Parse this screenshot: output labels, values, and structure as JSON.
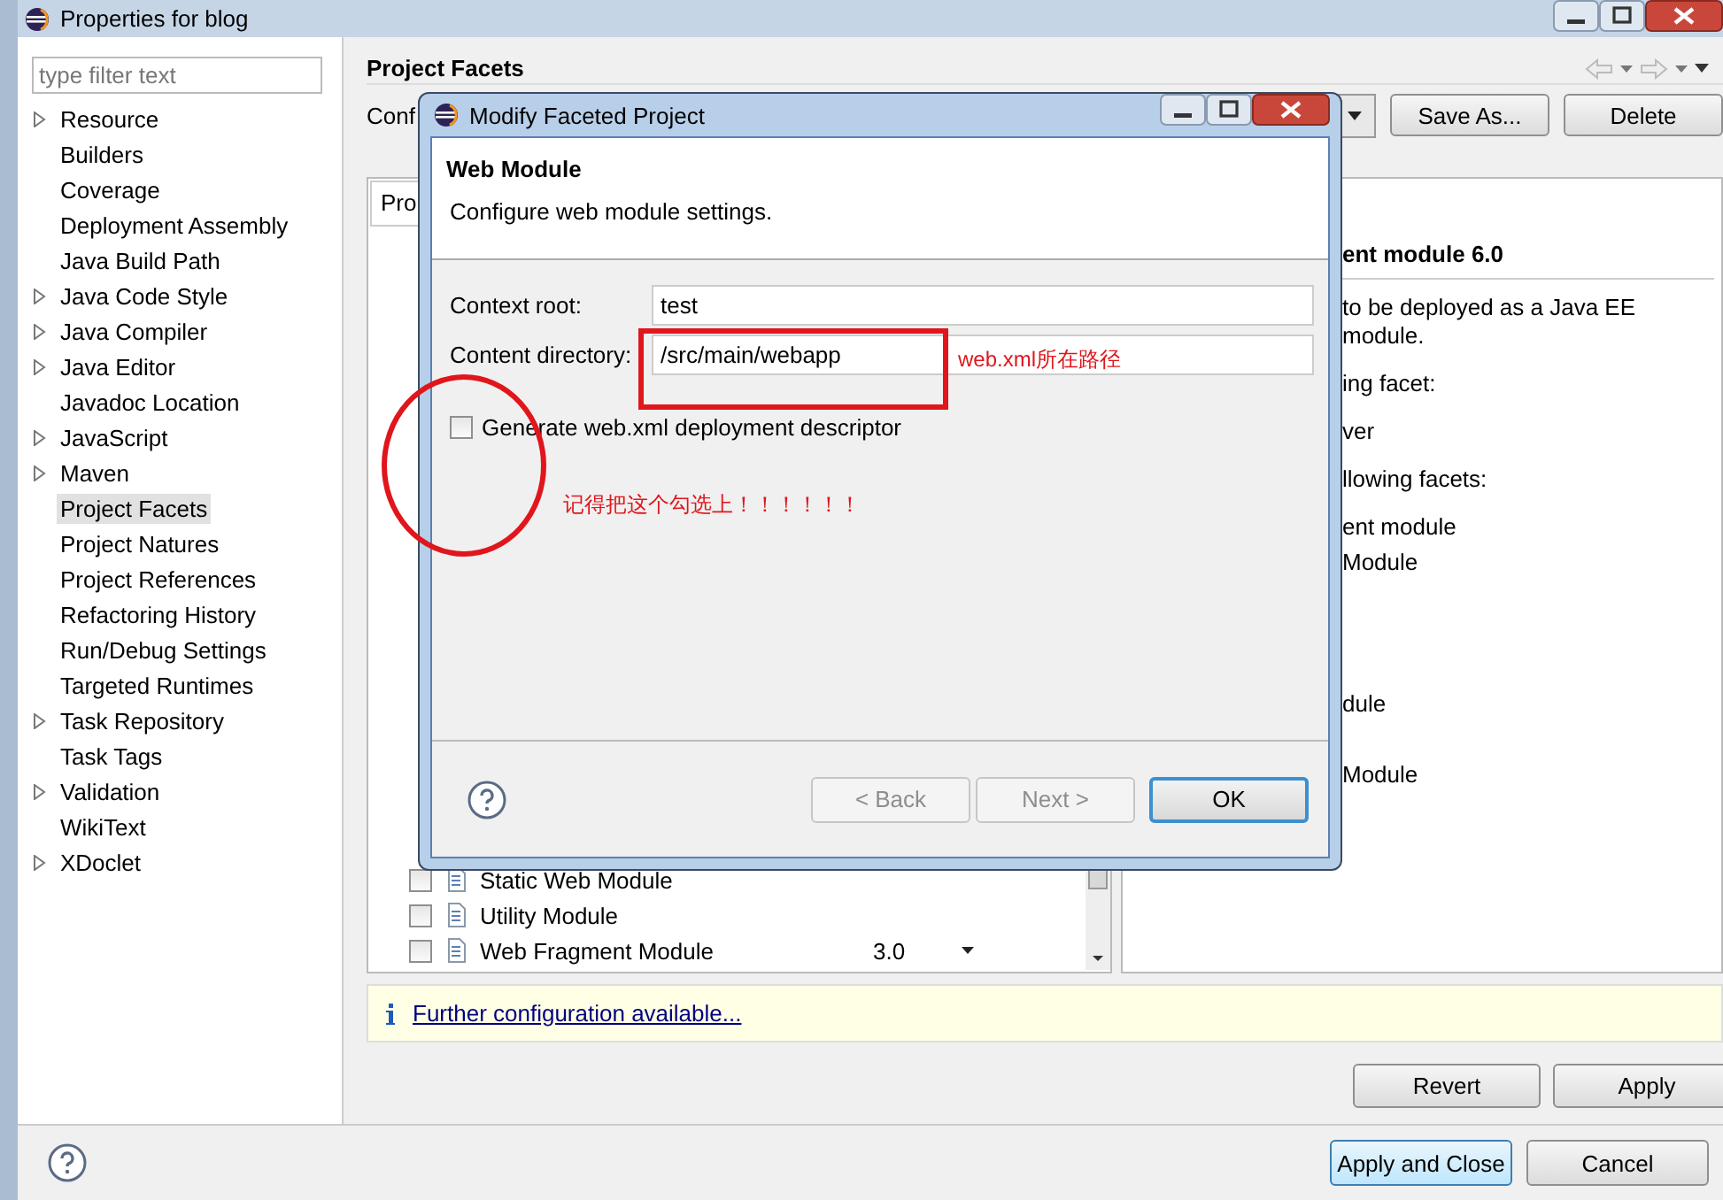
{
  "window": {
    "title": "Properties for blog"
  },
  "sidebar": {
    "filter_placeholder": "type filter text",
    "items": [
      {
        "label": "Resource",
        "expandable": true,
        "selected": false
      },
      {
        "label": "Builders",
        "expandable": false,
        "selected": false
      },
      {
        "label": "Coverage",
        "expandable": false,
        "selected": false
      },
      {
        "label": "Deployment Assembly",
        "expandable": false,
        "selected": false
      },
      {
        "label": "Java Build Path",
        "expandable": false,
        "selected": false
      },
      {
        "label": "Java Code Style",
        "expandable": true,
        "selected": false
      },
      {
        "label": "Java Compiler",
        "expandable": true,
        "selected": false
      },
      {
        "label": "Java Editor",
        "expandable": true,
        "selected": false
      },
      {
        "label": "Javadoc Location",
        "expandable": false,
        "selected": false
      },
      {
        "label": "JavaScript",
        "expandable": true,
        "selected": false
      },
      {
        "label": "Maven",
        "expandable": true,
        "selected": false
      },
      {
        "label": "Project Facets",
        "expandable": false,
        "selected": true
      },
      {
        "label": "Project Natures",
        "expandable": false,
        "selected": false
      },
      {
        "label": "Project References",
        "expandable": false,
        "selected": false
      },
      {
        "label": "Refactoring History",
        "expandable": false,
        "selected": false
      },
      {
        "label": "Run/Debug Settings",
        "expandable": false,
        "selected": false
      },
      {
        "label": "Targeted Runtimes",
        "expandable": false,
        "selected": false
      },
      {
        "label": "Task Repository",
        "expandable": true,
        "selected": false
      },
      {
        "label": "Task Tags",
        "expandable": false,
        "selected": false
      },
      {
        "label": "Validation",
        "expandable": true,
        "selected": false
      },
      {
        "label": "WikiText",
        "expandable": false,
        "selected": false
      },
      {
        "label": "XDoclet",
        "expandable": true,
        "selected": false
      }
    ]
  },
  "page": {
    "title": "Project Facets",
    "config_label": "Conf",
    "buttons": [
      "Save As...",
      "Delete"
    ],
    "tab": "Pro",
    "facets": [
      {
        "label": "Static Web Module",
        "checked": false
      },
      {
        "label": "Utility Module",
        "checked": false
      },
      {
        "label": "Web Fragment Module",
        "checked": false,
        "version": "3.0"
      }
    ],
    "details": {
      "title": "ent module 6.0",
      "lines": [
        "to be deployed as a Java EE",
        "module.",
        "ing facet:",
        "ver",
        "llowing facets:",
        "ent module",
        "Module",
        "dule",
        "Module"
      ]
    },
    "info": "Further configuration available...",
    "actions": [
      "Revert",
      "Apply"
    ]
  },
  "footer": {
    "buttons": [
      {
        "label": "Apply and Close",
        "default": true
      },
      {
        "label": "Cancel",
        "default": false
      }
    ]
  },
  "dialog": {
    "title": "Modify Faceted Project",
    "heading": "Web Module",
    "description": "Configure web module settings.",
    "fields": [
      {
        "label": "Context root:",
        "value": "test"
      },
      {
        "label": "Content directory:",
        "value": "/src/main/webapp"
      }
    ],
    "checkbox": {
      "label": "Generate web.xml deployment descriptor",
      "checked": false
    },
    "buttons": [
      {
        "label": "< Back",
        "disabled": true,
        "default": false
      },
      {
        "label": "Next >",
        "disabled": true,
        "default": false
      },
      {
        "label": "OK",
        "disabled": false,
        "default": true
      }
    ]
  },
  "annotations": [
    "web.xml所在路径",
    "记得把这个勾选上！！！！！！"
  ]
}
